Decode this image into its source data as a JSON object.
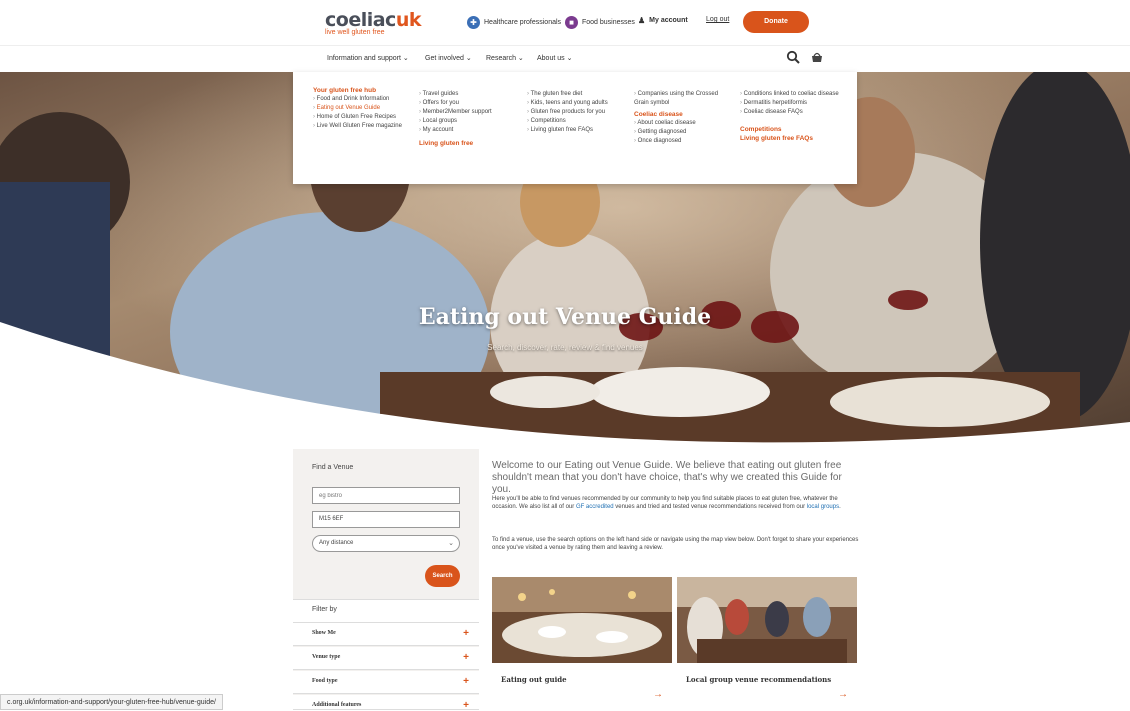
{
  "header": {
    "logo_main": "coeliac",
    "logo_mark": "uk",
    "logo_tag": "live well gluten free",
    "links": [
      {
        "icon": "stethoscope-icon",
        "label": "Healthcare professionals",
        "color": "#3b6fb6"
      },
      {
        "icon": "store-icon",
        "label": "Food businesses",
        "color": "#7b3b8f"
      },
      {
        "icon": "person-icon",
        "label": "My account",
        "color": "#444444"
      }
    ],
    "logout_label": "Log out",
    "donate_label": "Donate"
  },
  "nav": {
    "items": [
      "Information and support",
      "Get involved",
      "Research",
      "About us"
    ]
  },
  "mega_menu": {
    "col1": {
      "heading": "Your gluten free hub",
      "items": [
        "Food and Drink Information",
        "Eating out Venue Guide",
        "Home of Gluten Free Recipes",
        "Live Well Gluten Free magazine"
      ]
    },
    "col2": {
      "items": [
        "Travel guides",
        "Offers for you",
        "Member2Member support",
        "Local groups",
        "My account"
      ],
      "footer": "Living gluten free"
    },
    "col3": {
      "items": [
        "The gluten free diet",
        "Kids, teens and young adults",
        "Gluten free products for you",
        "Competitions",
        "Living gluten free FAQs"
      ]
    },
    "col4": {
      "items": [
        "Companies using the Crossed Grain symbol"
      ],
      "heading2": "Coeliac disease",
      "items2": [
        "About coeliac disease",
        "Getting diagnosed",
        "Once diagnosed"
      ]
    },
    "col5": {
      "items": [
        "Conditions linked to coeliac disease",
        "Dermatitis herpetiformis",
        "Coeliac disease FAQs"
      ],
      "heading2": "Competitions",
      "heading3": "Living gluten free FAQs"
    }
  },
  "hero": {
    "title": "Eating out Venue Guide",
    "subtitle": "Search, discover, rate, review & find venues"
  },
  "finder": {
    "title": "Find a Venue",
    "keyword_placeholder": "eg bistro",
    "postcode_value": "M15 6EF",
    "distance_value": "Any distance",
    "search_label": "Search",
    "filter_title": "Filter by",
    "filters": [
      "Show Me",
      "Venue type",
      "Food type",
      "Additional features"
    ]
  },
  "content": {
    "welcome": "Welcome to our Eating out Venue Guide. We believe that eating out gluten free shouldn't mean that you don't have choice, that's why we created this Guide for you.",
    "para1_a": "Here you'll be able to find venues recommended by our community to help you find suitable places to eat gluten free, whatever the occasion. We also list all of our ",
    "para1_link1": "GF accredited",
    "para1_b": " venues and tried and tested venue recommendations received from our ",
    "para1_link2": "local groups",
    "para1_c": ".",
    "para2": "To find a venue, use the search options on the left hand side or navigate using the map view below. Don't forget to share your experiences once you've visited a venue by rating them and leaving a review.",
    "cards": [
      {
        "caption": "Eating out guide"
      },
      {
        "caption": "Local group venue recommendations"
      }
    ]
  },
  "status_url": "c.org.uk/information-and-support/your-gluten-free-hub/venue-guide/",
  "colors": {
    "accent": "#d9541b",
    "link": "#1f6fb2",
    "text": "#333333"
  }
}
